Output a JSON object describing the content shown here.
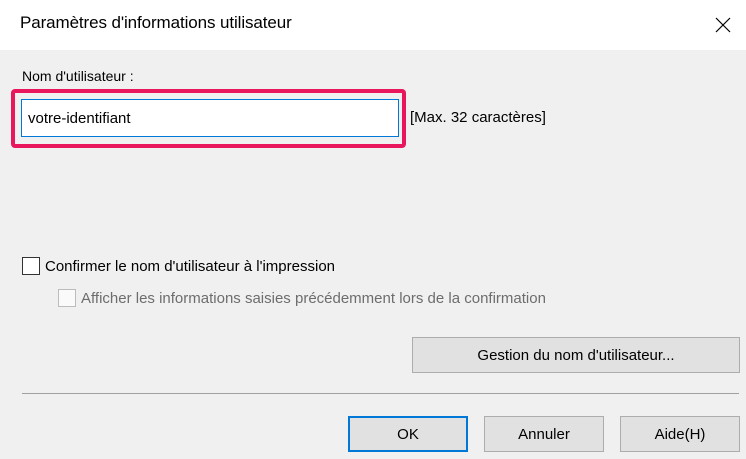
{
  "dialog": {
    "title": "Paramètres d'informations utilisateur",
    "close_icon": "close-icon"
  },
  "username": {
    "label": "Nom d'utilisateur :",
    "value": "votre-identifiant",
    "hint": "[Max. 32 caractères]",
    "highlight_color": "#e8175d"
  },
  "options": {
    "confirm_label": "Confirmer le nom d'utilisateur à l'impression",
    "confirm_checked": false,
    "show_previous_label": "Afficher les informations saisies précédemment lors de la confirmation",
    "show_previous_checked": false,
    "show_previous_enabled": false
  },
  "buttons": {
    "manage_label": "Gestion du nom d'utilisateur...",
    "ok_label": "OK",
    "cancel_label": "Annuler",
    "help_label": "Aide(H)"
  },
  "colors": {
    "focus": "#0078d7",
    "button_face": "#e1e1e1",
    "dialog_bg": "#f0f0f0"
  }
}
